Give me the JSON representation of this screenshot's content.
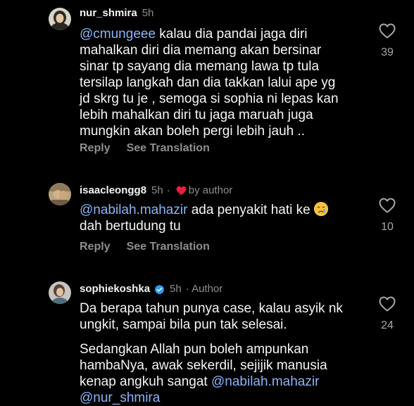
{
  "comments": [
    {
      "username": "nur_shmira",
      "time": "5h",
      "mention": "@cmungeee",
      "lines": [
        " kalau dia pandai jaga diri",
        "mahalkan diri dia memang akan bersinar",
        "sinar tp sayang dia memang lawa tp tula",
        "tersilap langkah dan dia takkan lalui ape yg",
        "jd skrg tu je , semoga si sophia ni lepas kan",
        "lebih mahalkan diri tu jaga maruah juga",
        "mungkin akan boleh pergi lebih jauh .."
      ],
      "reply_label": "Reply",
      "translate_label": "See Translation",
      "like_count": "39"
    },
    {
      "username": "isaacleongg8",
      "time": "5h",
      "by_author": "by author",
      "mention": "@nabilah.mahazir",
      "line1_rest": " ada penyakit hati ke ",
      "line2": "dah bertudung tu",
      "reply_label": "Reply",
      "translate_label": "See Translation",
      "like_count": "10"
    },
    {
      "username": "sophiekoshka",
      "time": "5h",
      "author_tag": "· Author",
      "lines": [
        "Da berapa tahun punya case, kalau asyik nk",
        "ungkit, sampai bila pun tak selesai."
      ],
      "lines2": [
        "Sedangkan Allah pun boleh ampunkan",
        "hambaNya, awak sekerdil, sejijik manusia"
      ],
      "line_last_prefix": "kenap angkuh sangat ",
      "mention1": "@nabilah.mahazir",
      "mention2": "@nur_shmira",
      "like_count": "24"
    }
  ],
  "colors": {
    "background": "#000000",
    "text": "#f5f5f5",
    "secondary": "#8e8e8e",
    "mention": "#8ab4f8",
    "heart_red": "#ed1c3c",
    "verified_blue": "#2f9bf0"
  }
}
